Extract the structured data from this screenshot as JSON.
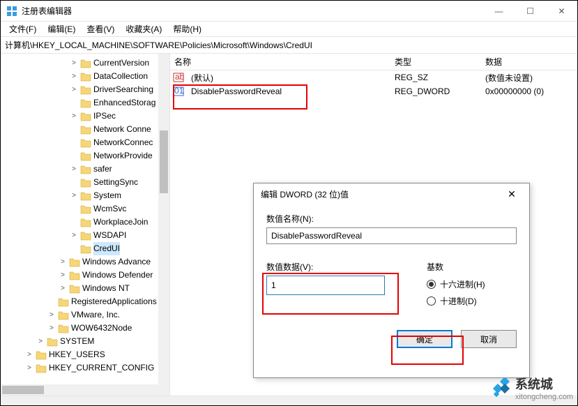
{
  "titlebar": {
    "title": "注册表编辑器"
  },
  "menubar": {
    "items": [
      "文件(F)",
      "编辑(E)",
      "查看(V)",
      "收藏夹(A)",
      "帮助(H)"
    ]
  },
  "addressbar": {
    "path": "计算机\\HKEY_LOCAL_MACHINE\\SOFTWARE\\Policies\\Microsoft\\Windows\\CredUI"
  },
  "tree": {
    "items": [
      {
        "indent": 4,
        "exp": ">",
        "label": "CurrentVersion"
      },
      {
        "indent": 4,
        "exp": ">",
        "label": "DataCollection"
      },
      {
        "indent": 4,
        "exp": ">",
        "label": "DriverSearching"
      },
      {
        "indent": 4,
        "exp": "",
        "label": "EnhancedStorag"
      },
      {
        "indent": 4,
        "exp": ">",
        "label": "IPSec"
      },
      {
        "indent": 4,
        "exp": "",
        "label": "Network Conne"
      },
      {
        "indent": 4,
        "exp": "",
        "label": "NetworkConnec"
      },
      {
        "indent": 4,
        "exp": "",
        "label": "NetworkProvide"
      },
      {
        "indent": 4,
        "exp": ">",
        "label": "safer"
      },
      {
        "indent": 4,
        "exp": "",
        "label": "SettingSync"
      },
      {
        "indent": 4,
        "exp": ">",
        "label": "System"
      },
      {
        "indent": 4,
        "exp": "",
        "label": "WcmSvc"
      },
      {
        "indent": 4,
        "exp": "",
        "label": "WorkplaceJoin"
      },
      {
        "indent": 4,
        "exp": ">",
        "label": "WSDAPI"
      },
      {
        "indent": 4,
        "exp": "",
        "label": "CredUI",
        "selected": true
      },
      {
        "indent": 3,
        "exp": ">",
        "label": "Windows Advance"
      },
      {
        "indent": 3,
        "exp": ">",
        "label": "Windows Defender"
      },
      {
        "indent": 3,
        "exp": ">",
        "label": "Windows NT"
      },
      {
        "indent": 2,
        "exp": "",
        "label": "RegisteredApplications"
      },
      {
        "indent": 2,
        "exp": ">",
        "label": "VMware, Inc."
      },
      {
        "indent": 2,
        "exp": ">",
        "label": "WOW6432Node"
      },
      {
        "indent": 1,
        "exp": ">",
        "label": "SYSTEM"
      },
      {
        "indent": 0,
        "exp": ">",
        "label": "HKEY_USERS"
      },
      {
        "indent": 0,
        "exp": ">",
        "label": "HKEY_CURRENT_CONFIG"
      }
    ]
  },
  "list": {
    "columns": {
      "name": "名称",
      "type": "类型",
      "data": "数据"
    },
    "rows": [
      {
        "icon": "string",
        "name": "(默认)",
        "type": "REG_SZ",
        "data": "(数值未设置)"
      },
      {
        "icon": "dword",
        "name": "DisablePasswordReveal",
        "type": "REG_DWORD",
        "data": "0x00000000 (0)"
      }
    ]
  },
  "dialog": {
    "title": "编辑 DWORD (32 位)值",
    "name_label": "数值名称(N):",
    "name_value": "DisablePasswordReveal",
    "value_label": "数值数据(V):",
    "value_value": "1",
    "base_label": "基数",
    "radio_hex": "十六进制(H)",
    "radio_dec": "十进制(D)",
    "ok": "确定",
    "cancel": "取消"
  },
  "watermark": {
    "text": "系统城",
    "url": "xitongcheng.com"
  }
}
